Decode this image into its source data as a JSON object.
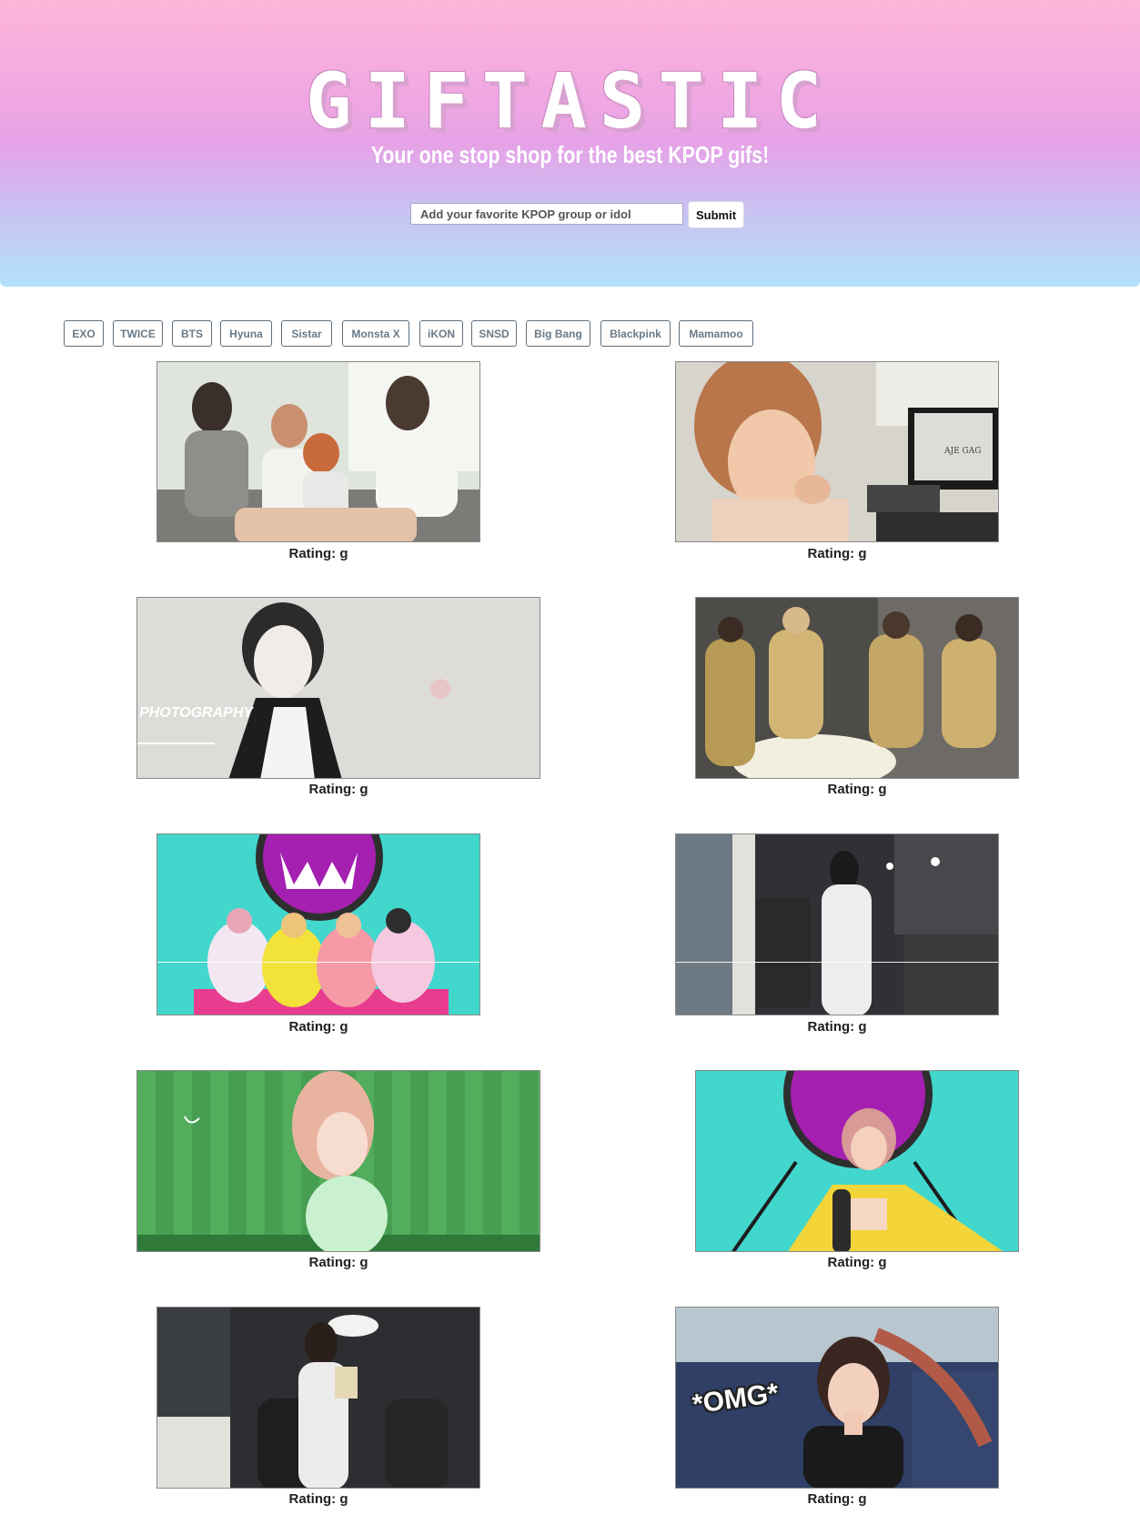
{
  "header": {
    "title": "GIFTASTIC",
    "subtitle": "Your one stop shop for the best KPOP gifs!",
    "search_placeholder": "Add your favorite KPOP group or idol",
    "submit_label": "Submit"
  },
  "groups": [
    "EXO",
    "TWICE",
    "BTS",
    "Hyuna",
    "Sistar",
    "Monsta X",
    "iKON",
    "SNSD",
    "Big Bang",
    "Blackpink",
    "Mamamoo"
  ],
  "gifs": [
    {
      "rating": "Rating: g",
      "scene": "group-laughing-on-couch"
    },
    {
      "rating": "Rating: g",
      "scene": "woman-at-computer-desk",
      "screen_text": "AJE GAG"
    },
    {
      "rating": "Rating: g",
      "scene": "black-white-portrait",
      "overlay_text": "PHOTOGRAPHY"
    },
    {
      "rating": "Rating: g",
      "scene": "gold-outfits-dance"
    },
    {
      "rating": "Rating: g",
      "scene": "colorful-group-on-turquoise"
    },
    {
      "rating": "Rating: g",
      "scene": "white-outfit-dance-bar"
    },
    {
      "rating": "Rating: g",
      "scene": "green-background-dancer"
    },
    {
      "rating": "Rating: g",
      "scene": "singer-with-microphone"
    },
    {
      "rating": "Rating: g",
      "scene": "bar-dance-crew"
    },
    {
      "rating": "Rating: g",
      "scene": "omg-reaction",
      "overlay_text": "*OMG*"
    }
  ],
  "colors": {
    "gradient_top": "#fdb6da",
    "gradient_mid": "#e6a2e6",
    "gradient_bottom": "#b2e1fb",
    "button_border": "#5e6f7d"
  }
}
